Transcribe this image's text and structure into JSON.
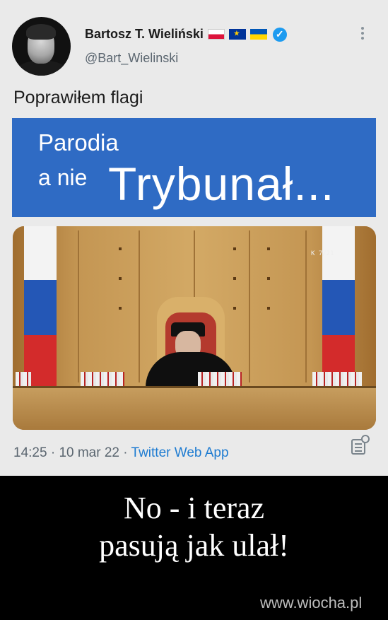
{
  "tweet": {
    "author_name": "Bartosz T. Wieliński",
    "handle": "@Bart_Wielinski",
    "flags": [
      "pl-flag-icon",
      "eu-flag-icon",
      "ua-flag-icon"
    ],
    "verified_icon": "verified-badge-icon",
    "more_icon": "more-options-icon",
    "text": "Poprawiłem flagi",
    "banner": {
      "line1": "Parodia",
      "line2": "a nie",
      "line3": "Trybunał...",
      "background": "#2f6bc4"
    },
    "photo": {
      "camera_label": "K 7/21",
      "flag_colors": [
        "#f3f3f3",
        "#2457b6",
        "#d32b2b"
      ]
    },
    "meta": {
      "time": "14:25",
      "date": "10 mar 22",
      "app": "Twitter Web App",
      "analytics_icon": "tweet-analytics-icon"
    }
  },
  "caption": {
    "line1": "No - i teraz",
    "line2": "pasują jak ulał!"
  },
  "watermark": "www.wiocha.pl",
  "colors": {
    "tweet_background": "#eaeaea",
    "link_blue": "#1d7bd1",
    "page_background": "#000000"
  }
}
